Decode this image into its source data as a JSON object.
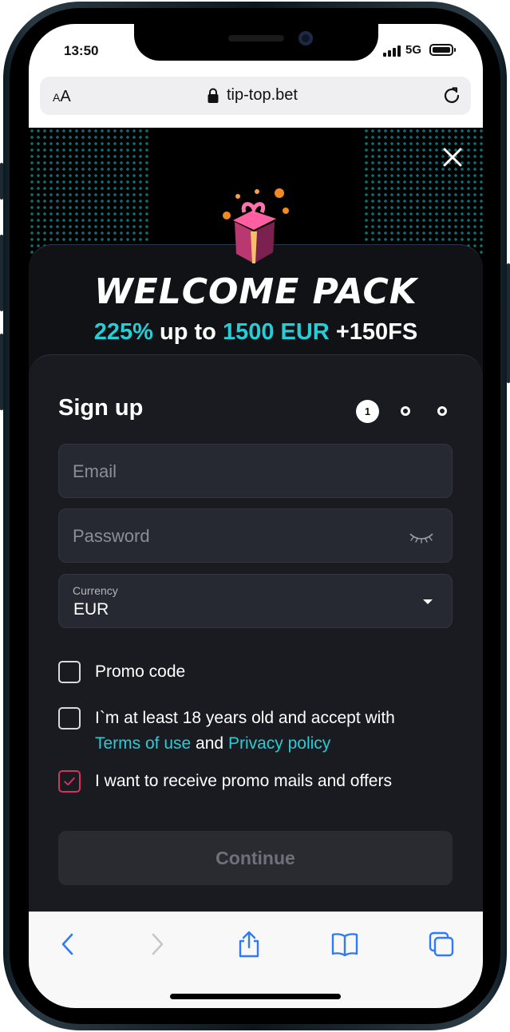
{
  "status_bar": {
    "time": "13:50",
    "network": "5G"
  },
  "browser": {
    "aa_small": "A",
    "aa_big": "A",
    "url": "tip-top.bet"
  },
  "promo": {
    "title": "WELCOME PACK",
    "bonus_percent": "225%",
    "bonus_mid": " up to ",
    "bonus_amount": "1500 EUR",
    "bonus_extra": " +150FS"
  },
  "form": {
    "heading": "Sign up",
    "step_current": "1",
    "steps_total": 3,
    "email": {
      "placeholder": "Email",
      "value": ""
    },
    "password": {
      "placeholder": "Password",
      "value": ""
    },
    "currency": {
      "label": "Currency",
      "value": "EUR"
    },
    "promo_code": {
      "label": "Promo code",
      "checked": false
    },
    "age_terms": {
      "text_before": "I`m at least 18 years old and accept with",
      "terms_link": "Terms of use",
      "and": " and ",
      "privacy_link": "Privacy policy",
      "checked": false
    },
    "promo_mails": {
      "label": "I want to receive promo mails and offers",
      "checked": true
    },
    "continue_label": "Continue"
  },
  "colors": {
    "accent_cyan": "#27cdd6",
    "checkbox_checked": "#d6335f",
    "page_bg": "#111216",
    "form_bg": "#1a1b20"
  },
  "icons": [
    "lock-icon",
    "reload-icon",
    "close-icon",
    "gift-icon",
    "eye-closed-icon",
    "dropdown-caret-icon",
    "check-icon",
    "back-icon",
    "forward-icon",
    "share-icon",
    "bookmarks-icon",
    "tabs-icon"
  ]
}
